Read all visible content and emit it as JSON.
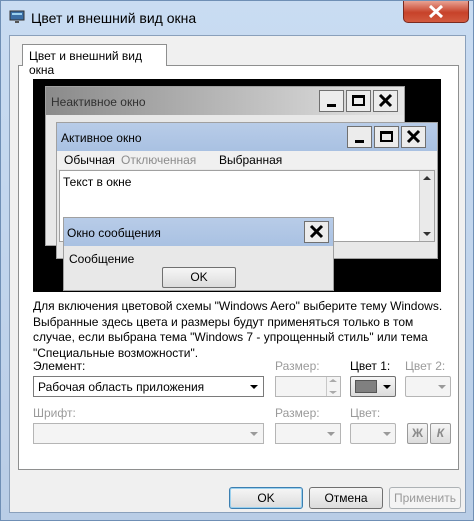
{
  "window": {
    "title": "Цвет и внешний вид окна",
    "icons": {
      "app": "monitor-icon",
      "close": "close-icon"
    }
  },
  "tab": {
    "label": "Цвет и внешний вид окна"
  },
  "preview": {
    "inactive_title": "Неактивное окно",
    "active_title": "Активное окно",
    "menu": {
      "normal": "Обычная",
      "disabled": "Отключенная",
      "selected": "Выбранная"
    },
    "window_text": "Текст в окне",
    "message_title": "Окно сообщения",
    "message_text": "Сообщение",
    "message_ok": "OK"
  },
  "info_text": "Для включения цветовой схемы \"Windows Aero\" выберите тему Windows. Выбранные здесь цвета и размеры будут применяться только в том случае, если выбрана тема \"Windows 7 - упрощенный стиль\" или тема \"Специальные возможности\".",
  "element": {
    "label": "Элемент:",
    "value": "Рабочая область приложения"
  },
  "size1": {
    "label": "Размер:",
    "value": ""
  },
  "color1": {
    "label": "Цвет 1:",
    "swatch": "#808080"
  },
  "color2": {
    "label": "Цвет 2:"
  },
  "font": {
    "label": "Шрифт:",
    "value": ""
  },
  "size2": {
    "label": "Размер:",
    "value": ""
  },
  "font_color": {
    "label": "Цвет:"
  },
  "bold_label": "Ж",
  "italic_label": "К",
  "buttons": {
    "ok": "OK",
    "cancel": "Отмена",
    "apply": "Применить"
  }
}
